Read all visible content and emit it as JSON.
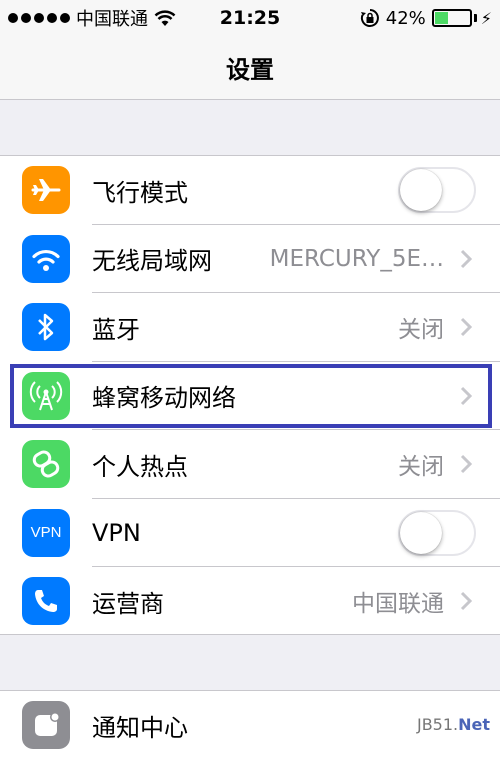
{
  "status_bar": {
    "carrier": "中国联通",
    "time": "21:25",
    "battery_percent": "42%",
    "battery_level": 0.42,
    "battery_color": "#4cd964"
  },
  "nav": {
    "title": "设置"
  },
  "settings": {
    "airplane": {
      "label": "飞行模式",
      "icon": "airplane-icon",
      "color": "#ff9500",
      "toggle_on": false
    },
    "wifi": {
      "label": "无线局域网",
      "value": "MERCURY_5E…",
      "icon": "wifi-icon",
      "color": "#007aff"
    },
    "bluetooth": {
      "label": "蓝牙",
      "value": "关闭",
      "icon": "bluetooth-icon",
      "color": "#007aff"
    },
    "cellular": {
      "label": "蜂窝移动网络",
      "icon": "cellular-antenna-icon",
      "color": "#4cd964"
    },
    "hotspot": {
      "label": "个人热点",
      "value": "关闭",
      "icon": "hotspot-link-icon",
      "color": "#4cd964"
    },
    "vpn": {
      "label": "VPN",
      "icon_text": "VPN",
      "color": "#007aff",
      "toggle_on": false
    },
    "carrier": {
      "label": "运营商",
      "value": "中国联通",
      "icon": "phone-icon",
      "color": "#007aff"
    },
    "notifications": {
      "label": "通知中心",
      "icon": "notification-center-icon",
      "color": "#8e8e93"
    }
  },
  "watermark": {
    "text": "JB51.",
    "net": "Net"
  }
}
